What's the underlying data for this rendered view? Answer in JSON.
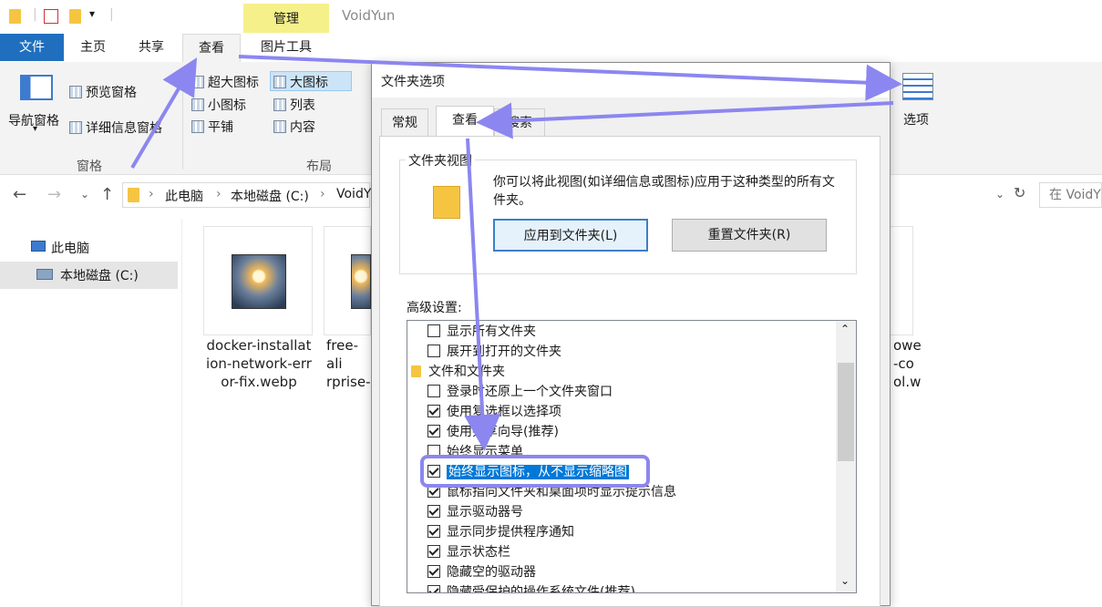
{
  "title_bar": {
    "context_tab": "管理",
    "app_title": "VoidYun"
  },
  "ribbon_tabs": [
    {
      "label": "文件"
    },
    {
      "label": "主页"
    },
    {
      "label": "共享"
    },
    {
      "label": "查看"
    },
    {
      "label": "图片工具"
    }
  ],
  "ribbon": {
    "pane_group": {
      "nav_pane": "导航窗格",
      "preview_pane": "预览窗格",
      "details_pane": "详细信息窗格",
      "label": "窗格"
    },
    "layout_group": {
      "items": [
        "超大图标",
        "大图标",
        "小图标",
        "列表",
        "平铺",
        "内容"
      ],
      "selected": "大图标",
      "label": "布局"
    },
    "options": "选项"
  },
  "address_bar": {
    "crumbs": [
      "此电脑",
      "本地磁盘 (C:)",
      "VoidY"
    ],
    "search_placeholder": "在 VoidY"
  },
  "nav_tree": {
    "this_pc": "此电脑",
    "local_disk": "本地磁盘 (C:)"
  },
  "files": [
    {
      "name": "docker-installat ion-network-err or-fix.webp"
    },
    {
      "name": "free-ali rprise-"
    },
    {
      "name": "owe -co ol.w"
    }
  ],
  "dialog": {
    "title": "文件夹选项",
    "tabs": [
      "常规",
      "查看",
      "搜索"
    ],
    "active_tab": "查看",
    "folder_views": {
      "legend": "文件夹视图",
      "description": "你可以将此视图(如详细信息或图标)应用于这种类型的所有文件夹。",
      "apply_button": "应用到文件夹(L)",
      "reset_button": "重置文件夹(R)"
    },
    "advanced_label": "高级设置:",
    "advanced_items": [
      {
        "label": "显示所有文件夹",
        "checked": false
      },
      {
        "label": "展开到打开的文件夹",
        "checked": false
      },
      {
        "label": "文件和文件夹",
        "folder": true
      },
      {
        "label": "登录时还原上一个文件夹窗口",
        "checked": false
      },
      {
        "label": "使用复选框以选择项",
        "checked": true
      },
      {
        "label": "使用共享向导(推荐)",
        "checked": true
      },
      {
        "label": "始终显示菜单",
        "checked": false
      },
      {
        "label": "始终显示图标，从不显示缩略图",
        "checked": true,
        "selected": true
      },
      {
        "label": "鼠标指向文件夹和桌面项时显示提示信息",
        "checked": true
      },
      {
        "label": "显示驱动器号",
        "checked": true
      },
      {
        "label": "显示同步提供程序通知",
        "checked": true
      },
      {
        "label": "显示状态栏",
        "checked": true
      },
      {
        "label": "隐藏空的驱动器",
        "checked": true
      },
      {
        "label": "隐藏受保护的操作系统文件(推荐)",
        "checked": true
      }
    ]
  },
  "colors": {
    "accent": "#1f6fbe",
    "annotation": "#8c86f0",
    "selection": "#0078d7"
  }
}
